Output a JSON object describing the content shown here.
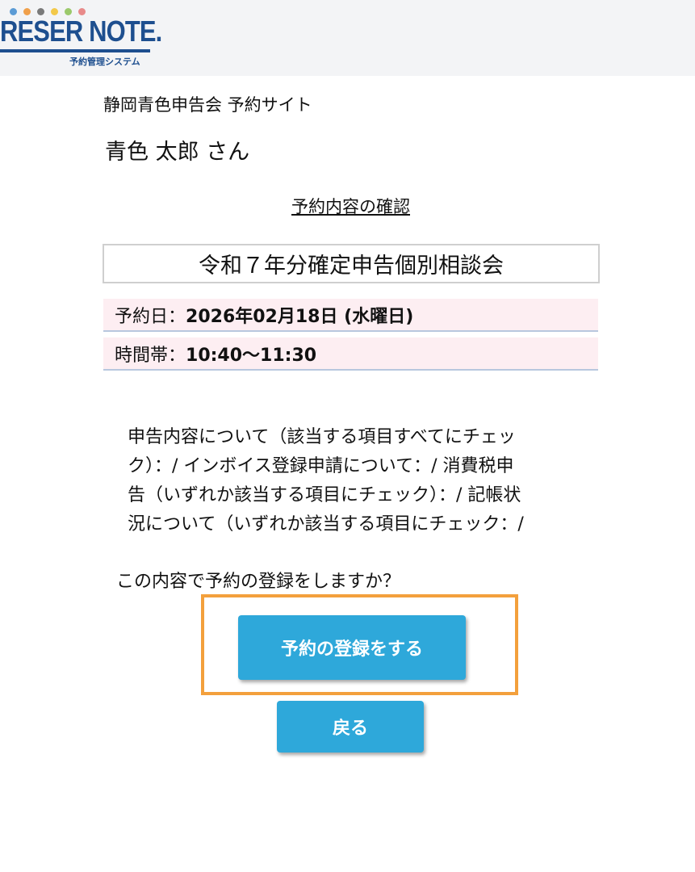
{
  "header": {
    "logo_text": "RESER NOTE.",
    "logo_subtitle": "予約管理システム",
    "logo_dot_colors": [
      "#5b9bd5",
      "#f0a04b",
      "#7a7a7a",
      "#f3c94a",
      "#9bc96b",
      "#e88a8a"
    ],
    "brand_color": "#1e4f8f"
  },
  "site_title": "静岡青色申告会 予約サイト",
  "user_name": "青色 太郎 さん",
  "page_heading": "予約内容の確認",
  "event_title": "令和７年分確定申告個別相談会",
  "reservation": {
    "date_label": "予約日：",
    "date_value": "2026年02月18日 (水曜日)",
    "time_label": "時間帯：",
    "time_value": "10:40〜11:30"
  },
  "consultation_lines": [
    "申告内容について（該当する項目すべてにチェッ",
    "ク）：/ インボイス登録申請について：/ 消費税申",
    "告（いずれか該当する項目にチェック）：/ 記帳状",
    "況について（いずれか該当する項目にチェック：/"
  ],
  "confirm_question": "この内容で予約の登録をしますか？",
  "buttons": {
    "register": "予約の登録をする",
    "back": "戻る"
  },
  "colors": {
    "button": "#2ea8da",
    "highlight": "#f3a03c",
    "row_background": "#fdeef2"
  }
}
